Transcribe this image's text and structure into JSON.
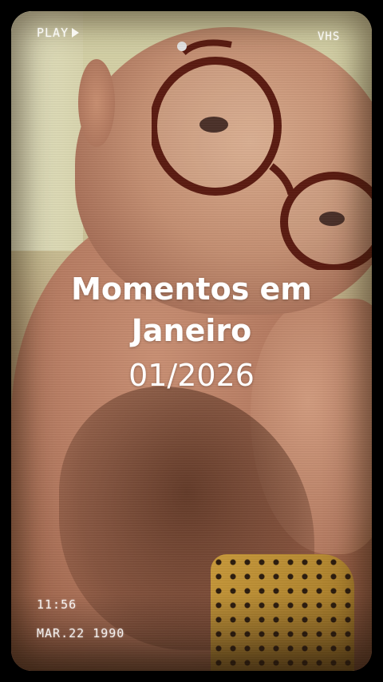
{
  "overlay": {
    "play_label": "PLAY",
    "play_icon": "play-triangle-icon",
    "vhs_label": "VHS",
    "time_label": "11:56",
    "date_label": "MAR.22 1990"
  },
  "title": {
    "main": "Momentos em Janeiro",
    "date": "01/2026"
  },
  "colors": {
    "background": "#000000",
    "text": "#ffffff"
  }
}
